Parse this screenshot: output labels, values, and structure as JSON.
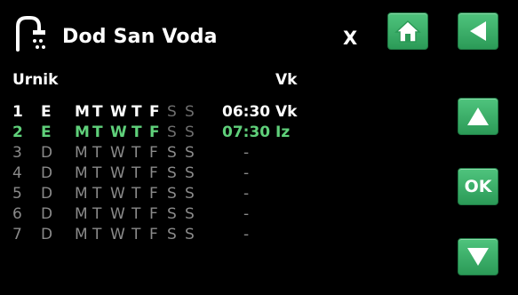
{
  "header": {
    "title": "Dod San Voda",
    "close_label": "X"
  },
  "table": {
    "col_label": "Urnik",
    "col_mode": "Vk",
    "rows": [
      {
        "num": "1",
        "mode": "E",
        "days": [
          "M",
          "T",
          "W",
          "T",
          "F",
          "S",
          "S"
        ],
        "time": "06:30",
        "val": "Vk",
        "state": "active"
      },
      {
        "num": "2",
        "mode": "E",
        "days": [
          "M",
          "T",
          "W",
          "T",
          "F",
          "S",
          "S"
        ],
        "time": "07:30",
        "val": "Iz",
        "state": "selected"
      },
      {
        "num": "3",
        "mode": "D",
        "days": [
          "M",
          "T",
          "W",
          "T",
          "F",
          "S",
          "S"
        ],
        "time": "-",
        "val": "",
        "state": "inactive"
      },
      {
        "num": "4",
        "mode": "D",
        "days": [
          "M",
          "T",
          "W",
          "T",
          "F",
          "S",
          "S"
        ],
        "time": "-",
        "val": "",
        "state": "inactive"
      },
      {
        "num": "5",
        "mode": "D",
        "days": [
          "M",
          "T",
          "W",
          "T",
          "F",
          "S",
          "S"
        ],
        "time": "-",
        "val": "",
        "state": "inactive"
      },
      {
        "num": "6",
        "mode": "D",
        "days": [
          "M",
          "T",
          "W",
          "T",
          "F",
          "S",
          "S"
        ],
        "time": "-",
        "val": "",
        "state": "inactive"
      },
      {
        "num": "7",
        "mode": "D",
        "days": [
          "M",
          "T",
          "W",
          "T",
          "F",
          "S",
          "S"
        ],
        "time": "-",
        "val": "",
        "state": "inactive"
      }
    ]
  },
  "buttons": {
    "ok_label": "OK"
  },
  "icons": {
    "header": "shower-tap-icon",
    "home": "home-icon",
    "back": "back-arrow-icon",
    "up": "arrow-up-icon",
    "down": "arrow-down-icon"
  },
  "colors": {
    "accent": "#3bb86b",
    "selected_text": "#5fd07a",
    "dim_text": "#8a8a8a",
    "background": "#000000"
  }
}
